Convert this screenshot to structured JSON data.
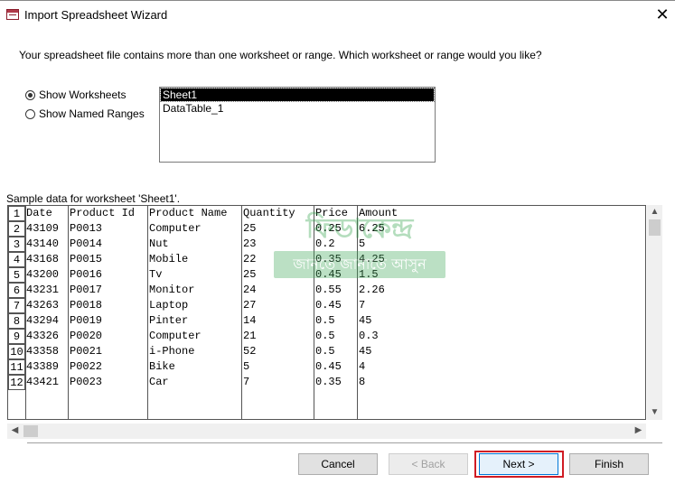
{
  "window": {
    "title": "Import Spreadsheet Wizard",
    "close_symbol": "✕",
    "accent": "#d01c24"
  },
  "intro_text": "Your spreadsheet file contains more than one worksheet or range. Which worksheet or range would you like?",
  "options": {
    "show_worksheets": {
      "label": "Show Worksheets",
      "selected": true
    },
    "show_named_ranges": {
      "label": "Show Named Ranges",
      "selected": false
    }
  },
  "worksheets": [
    "Sheet1",
    "DataTable_1"
  ],
  "selected_worksheet": "Sheet1",
  "sample_label": "Sample data for worksheet 'Sheet1'.",
  "table": {
    "columns": [
      "Date",
      "Product Id",
      "Product Name",
      "Quantity",
      "Price",
      "Amount"
    ],
    "row_numbers": [
      "1",
      "2",
      "3",
      "4",
      "5",
      "6",
      "7",
      "8",
      "9",
      "10",
      "11",
      "12"
    ],
    "rows": [
      [
        "43109",
        "P0013",
        "Computer",
        "25",
        "0.25",
        "6.25"
      ],
      [
        "43140",
        "P0014",
        "Nut",
        "23",
        "0.2",
        "5"
      ],
      [
        "43168",
        "P0015",
        "Mobile",
        "22",
        "0.35",
        "4.25"
      ],
      [
        "43200",
        "P0016",
        "Tv",
        "25",
        "0.45",
        "1.5"
      ],
      [
        "43231",
        "P0017",
        "Monitor",
        "24",
        "0.55",
        "2.26"
      ],
      [
        "43263",
        "P0018",
        "Laptop",
        "27",
        "0.45",
        "7"
      ],
      [
        "43294",
        "P0019",
        "Pinter",
        "14",
        "0.5",
        "45"
      ],
      [
        "43326",
        "P0020",
        "Computer",
        "21",
        "0.5",
        "0.3"
      ],
      [
        "43358",
        "P0021",
        "i-Phone",
        "52",
        "0.5",
        "45"
      ],
      [
        "43389",
        "P0022",
        "Bike",
        "5",
        "0.45",
        "4"
      ],
      [
        "43421",
        "P0023",
        "Car",
        "7",
        "0.35",
        "8"
      ]
    ]
  },
  "watermark": {
    "top": "ফিডাকেন্দ্র",
    "bottom": "জানতে জানাতে আসুন"
  },
  "scroll": {
    "up": "▲",
    "down": "▼",
    "left": "◀",
    "right": "▶"
  },
  "buttons": {
    "cancel": "Cancel",
    "back": "< Back",
    "next": "Next >",
    "finish": "Finish"
  }
}
